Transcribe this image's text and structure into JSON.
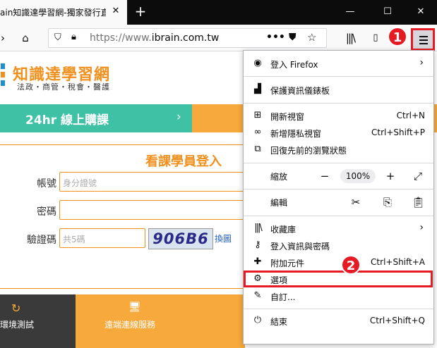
{
  "tab": {
    "title": "ain知識達學習網-獨家發行直",
    "close_icon": "close-icon",
    "new_tab_icon": "plus-icon"
  },
  "window_controls": {
    "minimize_icon": "minimize-icon",
    "maximize_icon": "maximize-icon",
    "close_icon": "close-icon"
  },
  "navbar": {
    "url_prefix": "https://www.",
    "url_host": "ibrain.com.tw",
    "page_actions_icon": "ellipsis-icon",
    "pocket_icon": "pocket-icon",
    "bookmark_icon": "star-icon",
    "library_icon": "library-icon",
    "menu_icon": "hamburger-icon"
  },
  "annotations": {
    "badge1": "1",
    "badge2": "2"
  },
  "page": {
    "logo_title": "知識達學習網",
    "logo_sub": "法政・商管・稅會・醫護",
    "green_banner": "24hr 線上購課",
    "green_arrow": "›",
    "login_title": "看課學員登入",
    "account_label": "帳號",
    "account_placeholder": "身分證號",
    "password_label": "密碼",
    "captcha_label": "驗證碼",
    "captcha_placeholder": "共5碼",
    "captcha_text": "906B6",
    "captcha_refresh": "換圖",
    "bottom_env": "環境測試",
    "bottom_remote": "遠端連線服務"
  },
  "menu": {
    "sign_in": "登入 Firefox",
    "privacy_dashboard": "保護資訊儀錶板",
    "new_window": "開新視窗",
    "new_window_shortcut": "Ctrl+N",
    "private_window": "新增隱私視窗",
    "private_window_shortcut": "Ctrl+Shift+P",
    "restore_session": "回復先前的瀏覽狀態",
    "zoom_label": "縮放",
    "zoom_minus": "−",
    "zoom_value": "100%",
    "zoom_plus": "+",
    "fullscreen_icon": "fullscreen-icon",
    "edit_label": "編輯",
    "cut_icon": "scissors-icon",
    "copy_icon": "copy-icon",
    "paste_icon": "paste-icon",
    "library": "收藏庫",
    "logins": "登入資訊與密碼",
    "addons": "附加元件",
    "addons_shortcut": "Ctrl+Shift+A",
    "options": "選項",
    "customize": "自訂...",
    "exit": "結束",
    "exit_shortcut": "Ctrl+Shift+Q"
  }
}
